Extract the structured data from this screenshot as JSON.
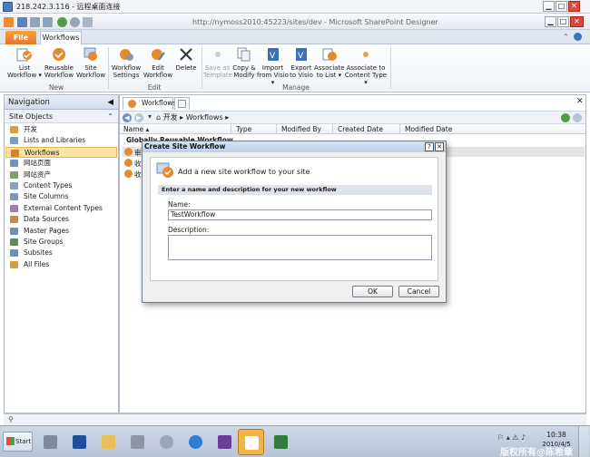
{
  "rdp": {
    "title": "218.242.3.116 - 远程桌面连接"
  },
  "window": {
    "title": "http://nymoss2010:45223/sites/dev - Microsoft SharePoint Designer",
    "minimize": "▁",
    "maximize": "□",
    "close": "✕"
  },
  "tabs": {
    "file": "File",
    "workflows": "Workflows"
  },
  "ribbon": {
    "new_group": "New",
    "edit_group": "Edit",
    "manage_group": "Manage",
    "list_workflow": [
      "List",
      "Workflow ▾"
    ],
    "reusable_workflow": [
      "Reusable",
      "Workflow"
    ],
    "site_workflow": [
      "Site",
      "Workflow"
    ],
    "workflow_settings": [
      "Workflow",
      "Settings"
    ],
    "edit_workflow": [
      "Edit",
      "Workflow"
    ],
    "delete": [
      "Delete",
      ""
    ],
    "save_as_template": [
      "Save as",
      "Template"
    ],
    "copy_modify": [
      "Copy &",
      "Modify"
    ],
    "import_visio": [
      "Import",
      "from Visio ▾"
    ],
    "export_visio": [
      "Export",
      "to Visio"
    ],
    "associate_list": [
      "Associate",
      "to List ▾"
    ],
    "associate_ct": [
      "Associate to",
      "Content Type ▾"
    ]
  },
  "nav": {
    "header": "Navigation",
    "site_objects": "Site Objects",
    "items": [
      {
        "label": "开发",
        "color": "#d8a03a"
      },
      {
        "label": "Lists and Libraries",
        "color": "#7a9bc6"
      },
      {
        "label": "Workflows",
        "color": "#d9812b"
      },
      {
        "label": "网站页面",
        "color": "#6f92c0"
      },
      {
        "label": "网站资产",
        "color": "#7aa36a"
      },
      {
        "label": "Content Types",
        "color": "#8a9fba"
      },
      {
        "label": "Site Columns",
        "color": "#7a98bd"
      },
      {
        "label": "External Content Types",
        "color": "#a37bb3"
      },
      {
        "label": "Data Sources",
        "color": "#c98a44"
      },
      {
        "label": "Master Pages",
        "color": "#6f8fb7"
      },
      {
        "label": "Site Groups",
        "color": "#5f8b5f"
      },
      {
        "label": "Subsites",
        "color": "#6d8fbd"
      },
      {
        "label": "All Files",
        "color": "#d8a03a"
      }
    ]
  },
  "main": {
    "tab_label": "Workflows",
    "breadcrumb": [
      "开发",
      "Workflows"
    ],
    "columns": [
      "Name",
      "Type",
      "Modified By",
      "Created Date",
      "Modified Date"
    ],
    "group_header": "Globally Reusable Workflow",
    "rows": [
      "审",
      "收",
      "收"
    ]
  },
  "dialog": {
    "title": "Create Site Workflow",
    "help": "?",
    "close": "✕",
    "heading": "Add a new site workflow to your site",
    "section": "Enter a name and description for your new workflow",
    "name_label": "Name:",
    "name_value": "TestWorkflow",
    "description_label": "Description:",
    "ok": "OK",
    "cancel": "Cancel"
  },
  "taskbar": {
    "start": "Start",
    "time": "10:38",
    "date": "2010/4/5",
    "watermark": "版权所有@陈希章"
  }
}
